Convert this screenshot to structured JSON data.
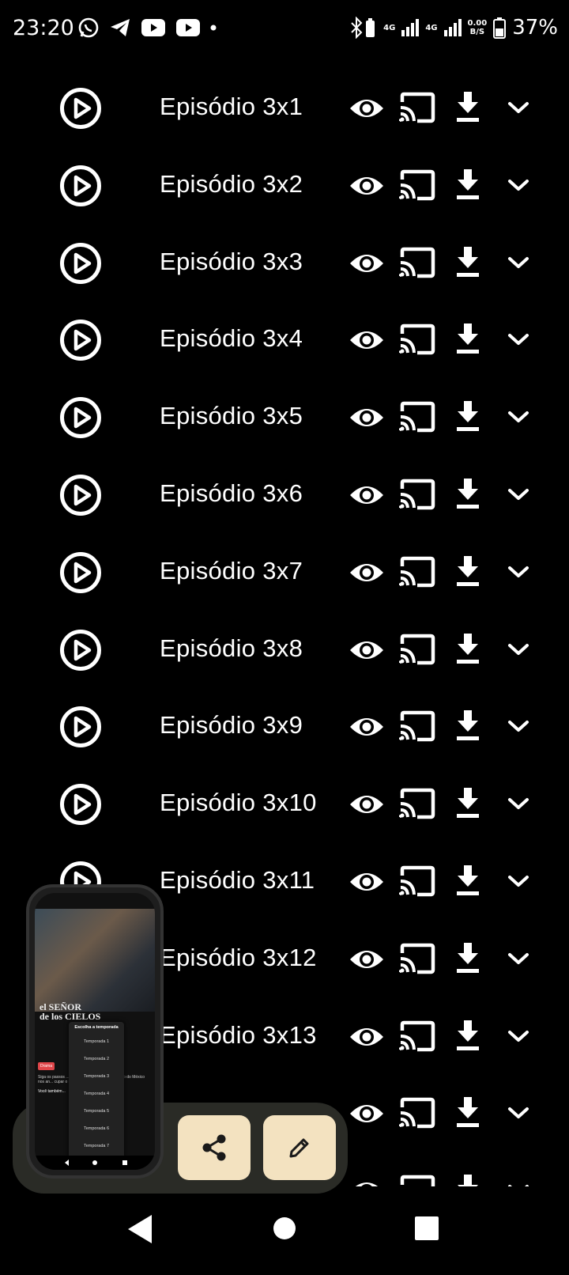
{
  "status_bar": {
    "time": "23:20",
    "network_1": "4G",
    "network_2": "4G",
    "speed_value": "0.00",
    "speed_unit": "B/S",
    "battery": "37%"
  },
  "episodes": [
    {
      "title": "Episódio 3x1"
    },
    {
      "title": "Episódio 3x2"
    },
    {
      "title": "Episódio 3x3"
    },
    {
      "title": "Episódio 3x4"
    },
    {
      "title": "Episódio 3x5"
    },
    {
      "title": "Episódio 3x6"
    },
    {
      "title": "Episódio 3x7"
    },
    {
      "title": "Episódio 3x8"
    },
    {
      "title": "Episódio 3x9"
    },
    {
      "title": "Episódio 3x10"
    },
    {
      "title": "Episódio 3x11"
    },
    {
      "title": "Episódio 3x12"
    },
    {
      "title": "Episódio 3x13"
    },
    {
      "title": ""
    },
    {
      "title": ""
    }
  ],
  "screenshot_thumb": {
    "poster_title_1": "el SEÑOR",
    "poster_title_2": "de los CIELOS",
    "menu_header": "Escolha a temporada",
    "menu_items": [
      "Temporada 1",
      "Temporada 2",
      "Temporada 3",
      "Temporada 4",
      "Temporada 5",
      "Temporada 6",
      "Temporada 7"
    ],
    "tags": [
      "Drama"
    ],
    "body_text": "Siga os passos ... odisséia para transform... canto do México nos an... cupar o lugar de Pablo Esco...",
    "more_label": "Você também..."
  },
  "colors": {
    "background": "#000000",
    "fab_bg": "#f3e2c0",
    "bubble_bg": "#2a2b26"
  },
  "icons": {
    "play": "play-circle-icon",
    "watched": "eye-icon",
    "cast": "cast-icon",
    "download": "download-icon",
    "expand": "chevron-down-icon",
    "share": "share-icon",
    "edit": "pencil-icon"
  }
}
